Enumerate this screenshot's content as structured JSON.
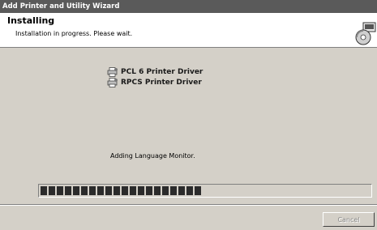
{
  "window": {
    "title": "Add Printer and Utility Wizard"
  },
  "header": {
    "title": "Installing",
    "subtitle": "Installation in progress. Please wait.",
    "icon": "install-cd-icon"
  },
  "drivers": [
    {
      "label": "PCL 6 Printer Driver",
      "icon": "printer-driver-icon"
    },
    {
      "label": "RPCS Printer Driver",
      "icon": "printer-driver-icon"
    }
  ],
  "status": {
    "text": "Adding Language Monitor."
  },
  "progress": {
    "percent": 51
  },
  "footer": {
    "cancel_label": "Cancel",
    "cancel_enabled": false
  },
  "colors": {
    "titlebar": "#5a5a5a",
    "face": "#d4d0c8",
    "progress_fill": "#2b2b2b"
  }
}
